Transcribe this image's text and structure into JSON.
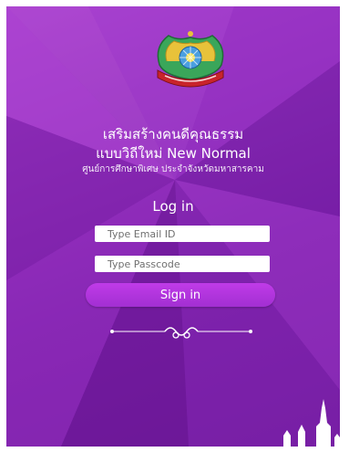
{
  "header": {
    "line1": "เสริมสร้างคนดีคุณธรรม",
    "line2": "แบบวิถีใหม่ New Normal",
    "line3": "ศูนย์การศึกษาพิเศษ ประจำจังหวัดมหาสารคาม"
  },
  "login": {
    "heading": "Log in",
    "email_placeholder": "Type Email ID",
    "passcode_placeholder": "Type Passcode",
    "signin_label": "Sign in"
  },
  "icons": {
    "logo": "school-emblem-icon",
    "divider": "ornament-divider-icon",
    "decoration": "temple-silhouette-icon"
  },
  "colors": {
    "background": "#8a2bb5",
    "button": "#b035e0",
    "text": "#ffffff"
  }
}
